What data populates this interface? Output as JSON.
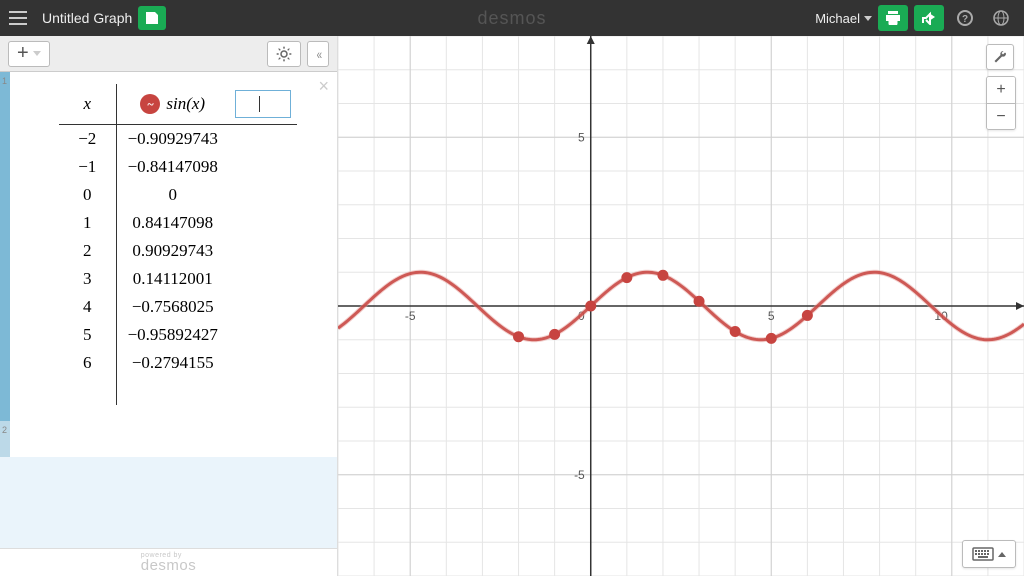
{
  "header": {
    "title": "Untitled Graph",
    "logo": "desmos",
    "user": "Michael"
  },
  "toolbar": {
    "add_label": "+"
  },
  "table": {
    "header_x": "x",
    "header_y": "sin(x)",
    "rows": [
      {
        "x": "−2",
        "y": "−0.90929743"
      },
      {
        "x": "−1",
        "y": "−0.84147098"
      },
      {
        "x": "0",
        "y": "0"
      },
      {
        "x": "1",
        "y": "0.84147098"
      },
      {
        "x": "2",
        "y": "0.90929743"
      },
      {
        "x": "3",
        "y": "0.14112001"
      },
      {
        "x": "4",
        "y": "−0.7568025"
      },
      {
        "x": "5",
        "y": "−0.95892427"
      },
      {
        "x": "6",
        "y": "−0.2794155"
      }
    ]
  },
  "expr_indices": {
    "row1": "1",
    "row2": "2"
  },
  "footer": {
    "powered": "powered by",
    "logo": "desmos"
  },
  "axis_labels": {
    "xneg5": "-5",
    "xpos5": "5",
    "xpos10": "10",
    "yneg5": "-5",
    "ypos5": "5",
    "origin": "0"
  },
  "chart_data": {
    "type": "line",
    "title": "",
    "xlabel": "",
    "ylabel": "",
    "xlim": [
      -7,
      12
    ],
    "ylim": [
      -8,
      8
    ],
    "series": [
      {
        "name": "sin(x)",
        "curve": "y = sin(x)",
        "color": "#c74440"
      }
    ],
    "points_x": [
      -2,
      -1,
      0,
      1,
      2,
      3,
      4,
      5,
      6
    ],
    "points_y": [
      -0.90929743,
      -0.84147098,
      0,
      0.84147098,
      0.90929743,
      0.14112001,
      -0.7568025,
      -0.95892427,
      -0.2794155
    ],
    "axis_ticks_x": [
      -5,
      0,
      5,
      10
    ],
    "axis_ticks_y": [
      -5,
      0,
      5
    ]
  }
}
